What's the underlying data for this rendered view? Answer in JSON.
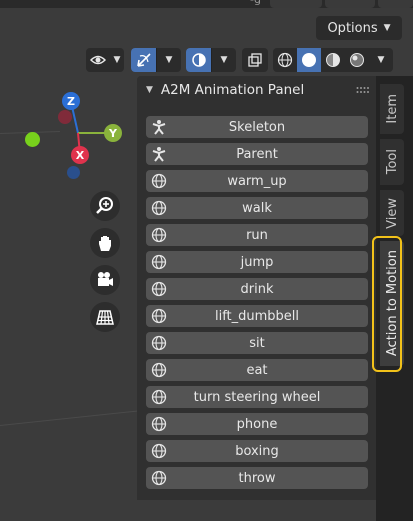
{
  "header": {
    "options_label": "Options",
    "options_chevron": "chevron-down-icon",
    "topbar_glyph": "-ġ"
  },
  "gizmo": {
    "z_label": "Z",
    "y_label": "Y",
    "x_label": "X",
    "colors": {
      "z": "#2b6fd6",
      "y": "#8ab33c",
      "x": "#e0334d",
      "green": "#78d11c"
    }
  },
  "nav_buttons": [
    "zoom-icon",
    "hand-pan-icon",
    "camera-icon",
    "grid-perspective-icon"
  ],
  "panel": {
    "title": "A2M Animation Panel",
    "buttons": [
      {
        "label": "Skeleton",
        "icon": "armature-icon"
      },
      {
        "label": "Parent",
        "icon": "armature-icon"
      },
      {
        "label": "warm_up",
        "icon": "globe-icon"
      },
      {
        "label": "walk",
        "icon": "globe-icon"
      },
      {
        "label": "run",
        "icon": "globe-icon"
      },
      {
        "label": "jump",
        "icon": "globe-icon"
      },
      {
        "label": "drink",
        "icon": "globe-icon"
      },
      {
        "label": "lift_dumbbell",
        "icon": "globe-icon"
      },
      {
        "label": "sit",
        "icon": "globe-icon"
      },
      {
        "label": "eat",
        "icon": "globe-icon"
      },
      {
        "label": "turn steering wheel",
        "icon": "globe-icon"
      },
      {
        "label": "phone",
        "icon": "globe-icon"
      },
      {
        "label": "boxing",
        "icon": "globe-icon"
      },
      {
        "label": "throw",
        "icon": "globe-icon"
      }
    ]
  },
  "tabs": [
    {
      "label": "Item"
    },
    {
      "label": "Tool"
    },
    {
      "label": "View"
    },
    {
      "label": "Action to Motion",
      "active": true
    }
  ],
  "highlight_color": "#f2c21a"
}
